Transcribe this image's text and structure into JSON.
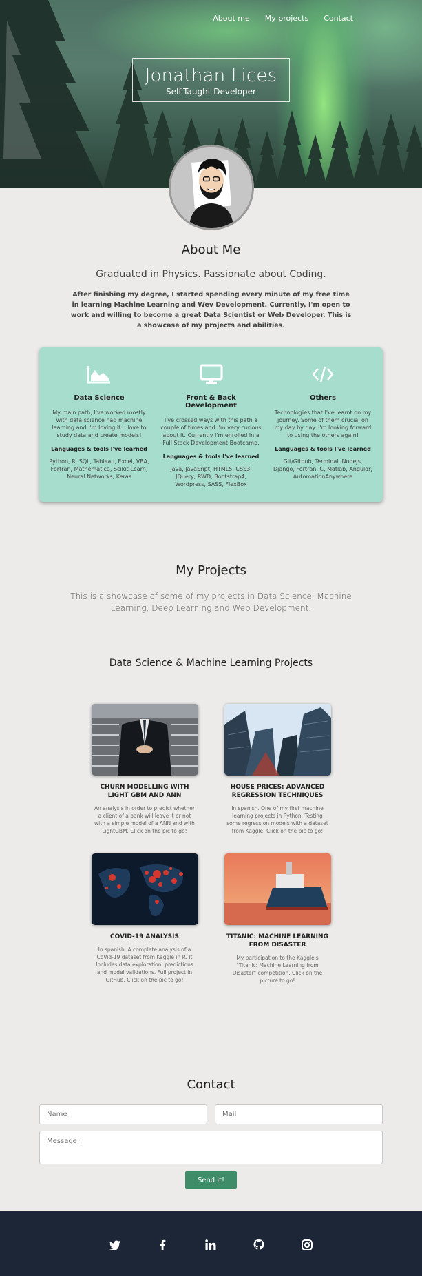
{
  "nav": {
    "items": [
      {
        "label": "About me"
      },
      {
        "label": "My projects"
      },
      {
        "label": "Contact"
      }
    ]
  },
  "hero": {
    "name": "Jonathan Lices",
    "subtitle": "Self-Taught Developer"
  },
  "about": {
    "title": "About Me",
    "subtitle": "Graduated in Physics. Passionate about Coding.",
    "text": "After finishing my degree, I started spending every minute of my free time in learning Machine Learning and Wev Development. Currently, I'm open to work and willing to become a great Data Scientist or Web Developer. This is a showcase of my projects and abilities."
  },
  "skills": [
    {
      "icon": "area-chart-icon",
      "title": "Data Science",
      "description": "My main path, I've worked mostly with data science nad machine learning and I'm loving it. I love to study data and create models!",
      "langs_title": "Languages & tools I've learned",
      "langs": "Python, R, SQL, Tableau, Excel, VBA, Fortran, Mathematica, Scikit-Learn, Neural Networks, Keras"
    },
    {
      "icon": "desktop-icon",
      "title": "Front & Back Development",
      "description": "I've crossed ways with this path a couple of times and I'm very curious about it. Currently I'm enrolled in a Full Stack Development Bootcamp.",
      "langs_title": "Languages & tools I've learned",
      "langs": "Java, JavaSript, HTML5, CSS3, JQuery, RWD, Bootstrap4, Wordpress, SASS, FlexBox"
    },
    {
      "icon": "code-icon",
      "title": "Others",
      "description": "Technologies that I've learnt on my journey. Some of them crucial on my day by day. I'm looking forward to using the others again!",
      "langs_title": "Languages & tools I've learned",
      "langs": "Git/Github, Terminal, NodeJs, Django, Fortran, C, Matlab, Angular, AutomationAnywhere"
    }
  ],
  "projects": {
    "title": "My Projects",
    "intro": "This is a showcase of some of my projects in Data Science, Machine Learning, Deep Learning and Web Development.",
    "ds_title": "Data Science & Machine Learning Projects",
    "items": [
      {
        "title": "CHURN MODELLING WITH LIGHT GBM AND ANN",
        "description": "An analysis in order to predict whether a client of a bank will leave it or not with a simple model of a ANN and with LightGBM. Click on the pic to go!"
      },
      {
        "title": "HOUSE PRICES: ADVANCED REGRESSION TECHNIQUES",
        "description": "In spanish. One of my first machine learning projects in Python. Testing some regression models with a dataset from Kaggle. Click on the pic to go!"
      },
      {
        "title": "COVID-19 ANALYSIS",
        "description": "In spanish. A complete analysis of a CoVid-19 dataset from Kaggle in R. It Includes data exploration, predictions and model validations. Full project in GitHub. Click on the pic to go!"
      },
      {
        "title": "TITANIC: MACHINE LEARNING FROM DISASTER",
        "description": "My participation to the Kaggle's \"Titanic: Machine Learning from Disaster\" competition. Click on the picture to go!"
      }
    ]
  },
  "contact": {
    "title": "Contact",
    "name_placeholder": "Name",
    "mail_placeholder": "Mail",
    "message_placeholder": "Message:",
    "send_label": "Send it!"
  },
  "footer": {
    "social": [
      "twitter-icon",
      "facebook-icon",
      "linkedin-icon",
      "github-icon",
      "instagram-icon"
    ]
  },
  "colors": {
    "skills_bg": "#a7ddcc",
    "send_button": "#3f8c68",
    "footer_bg": "#1c2637"
  }
}
